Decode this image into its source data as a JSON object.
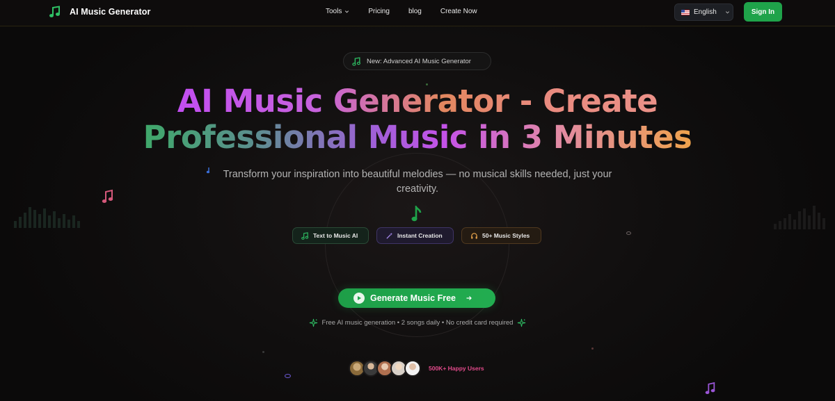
{
  "nav": {
    "logo_text": "AI Music Generator",
    "links": [
      {
        "label": "Tools",
        "has_dropdown": true
      },
      {
        "label": "Pricing"
      },
      {
        "label": "blog"
      },
      {
        "label": "Create Now"
      }
    ],
    "language": "English",
    "signin_label": "Sign In"
  },
  "hero": {
    "badge": "New: Advanced AI Music Generator",
    "headline_line1": "AI Music Generator - Create",
    "headline_line2": "Professional Music in 3 Minutes",
    "subtitle": "Transform your inspiration into beautiful melodies — no musical skills needed, just your creativity.",
    "features": [
      {
        "label": "Text to Music AI",
        "icon": "music-note-icon"
      },
      {
        "label": "Instant Creation",
        "icon": "magic-wand-icon"
      },
      {
        "label": "50+ Music Styles",
        "icon": "headphones-icon"
      }
    ],
    "cta_label": "Generate Music Free",
    "cta_note": "Free AI music generation • 2 songs daily • No credit card required",
    "users_label": "500K+ Happy Users"
  },
  "colors": {
    "accent_green": "#1fa34a",
    "users_pink": "#e24a8b",
    "background": "#0d0b0b"
  }
}
